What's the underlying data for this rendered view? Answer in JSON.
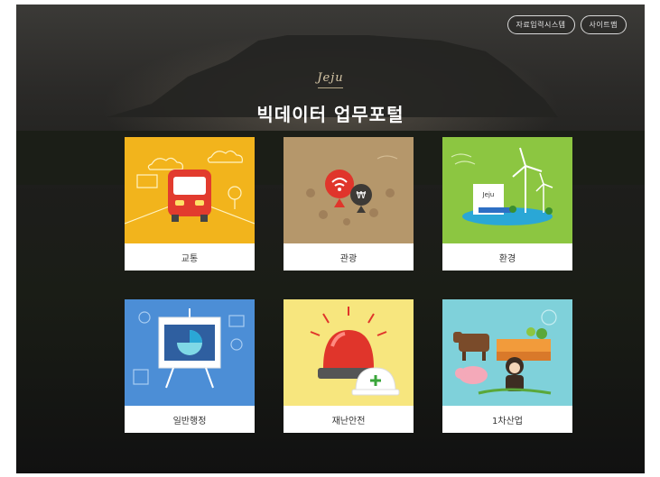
{
  "header": {
    "buttons": [
      {
        "label": "자료입력시스템"
      },
      {
        "label": "사이트맵"
      }
    ],
    "logo_text": "Jeju",
    "title": "빅데이터 업무포털"
  },
  "cards": [
    {
      "label": "교통",
      "color": "#f2b41c"
    },
    {
      "label": "관광",
      "color": "#b5976b"
    },
    {
      "label": "환경",
      "color": "#8cc641"
    },
    {
      "label": "일반행정",
      "color": "#4c8ed6"
    },
    {
      "label": "재난안전",
      "color": "#f7e67e"
    },
    {
      "label": "1차산업",
      "color": "#7fd1da"
    }
  ]
}
